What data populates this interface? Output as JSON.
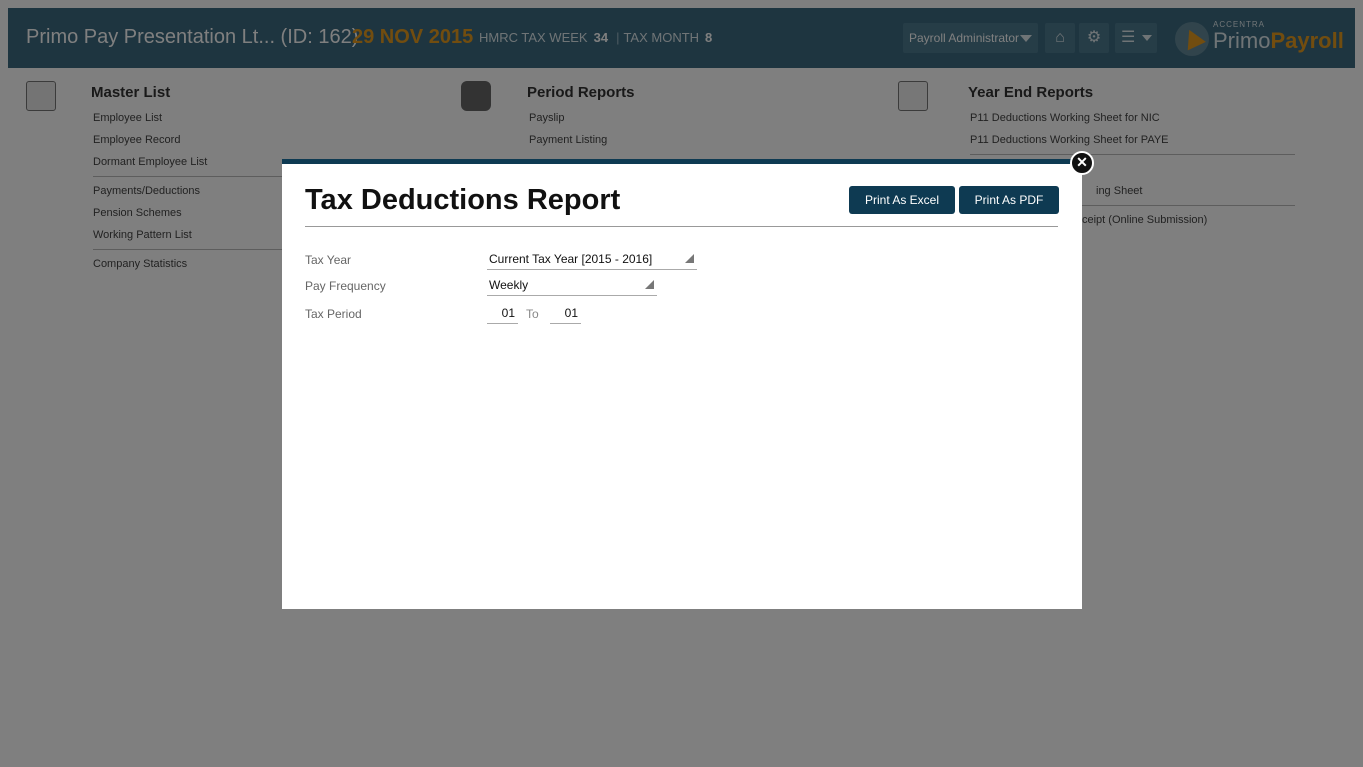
{
  "header": {
    "company": "Primo Pay Presentation Lt... (ID: 162)",
    "date": "29 NOV 2015",
    "tax_week_label": "HMRC TAX WEEK",
    "tax_week_value": "34",
    "tax_month_label": "TAX MONTH",
    "tax_month_value": "8",
    "role": "Payroll Administrator",
    "logo_small": "ACCENTRA",
    "logo_primo": "Primo",
    "logo_payroll": "Payroll"
  },
  "icons": {
    "home": "home-icon",
    "settings": "gear-icon",
    "menu": "hamburger-icon",
    "close": "close-icon"
  },
  "sections": {
    "master": {
      "title": "Master List",
      "links": [
        "Employee List",
        "Employee Record",
        "Dormant Employee List",
        "Payments/Deductions",
        "Pension Schemes",
        "Working Pattern List",
        "Company Statistics"
      ]
    },
    "period": {
      "title": "Period Reports",
      "links": [
        "Payslip",
        "Payment Listing"
      ]
    },
    "year_end": {
      "title": "Year End Reports",
      "links": [
        "P11 Deductions Working Sheet for NIC",
        "P11 Deductions Working Sheet for PAYE",
        "ing Sheet",
        "ceipt (Online Submission)"
      ]
    }
  },
  "modal": {
    "title": "Tax Deductions Report",
    "excel_label": "Print As Excel",
    "pdf_label": "Print As PDF",
    "tax_year_label": "Tax Year",
    "tax_year_value": "Current Tax Year [2015 - 2016]",
    "pay_frequency_label": "Pay Frequency",
    "pay_frequency_value": "Weekly",
    "tax_period_label": "Tax Period",
    "tax_period_from": "01",
    "tax_period_to_label": "To",
    "tax_period_to": "01"
  },
  "colors": {
    "header_bg": "#3d6b80",
    "accent": "#e59a1f",
    "modal_button": "#0e3a52"
  }
}
